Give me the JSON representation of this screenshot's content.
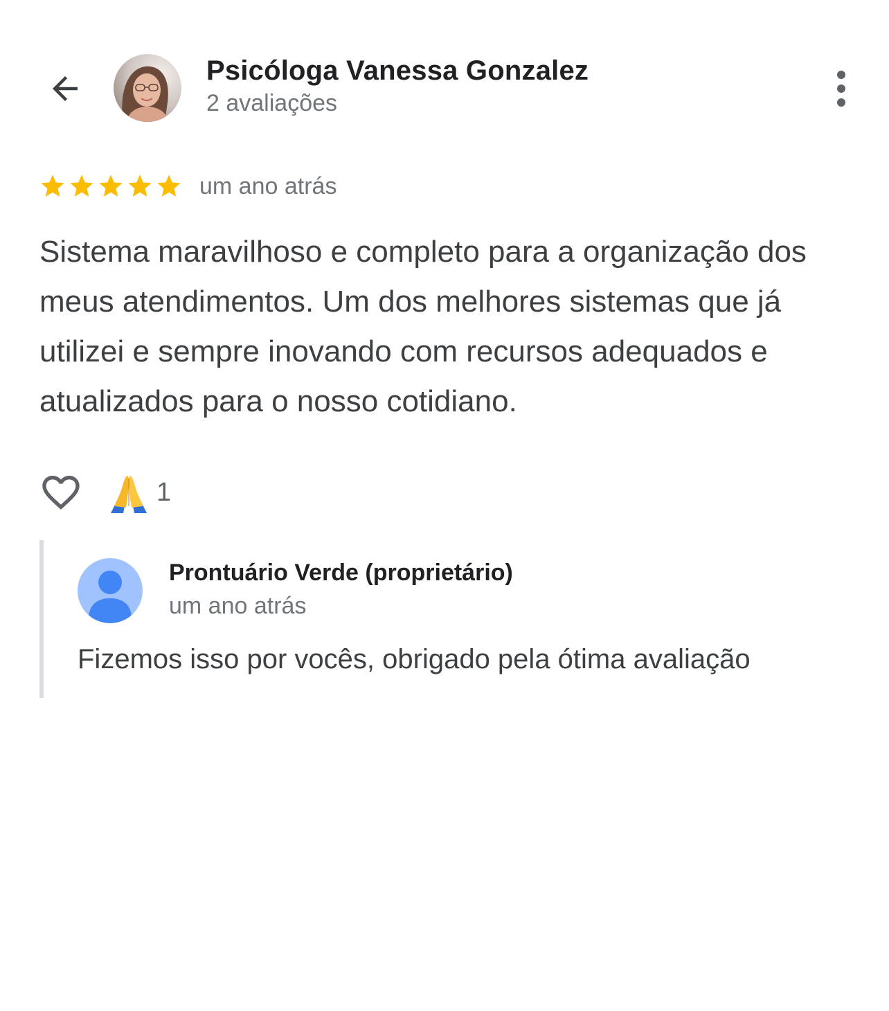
{
  "header": {
    "author_name": "Psicóloga Vanessa Gonzalez",
    "author_meta": "2 avaliações",
    "back_icon": "arrow-back-icon",
    "more_icon": "more-vert-icon"
  },
  "review": {
    "rating": 5,
    "rating_max": 5,
    "date": "um ano atrás",
    "star_color": "#fbbc04",
    "text": "Sistema maravilhoso e completo para a organização dos meus atendimentos. Um dos melhores sistemas que já utilizei e sempre inovando com recursos adequados e atualizados para o nosso cotidiano."
  },
  "reactions": {
    "like_icon": "heart-outline-icon",
    "emoji_icon": "folded-hands-emoji",
    "count": "1"
  },
  "owner_reply": {
    "name": "Prontuário Verde (proprietário)",
    "date": "um ano atrás",
    "text": "Fizemos isso por vocês, obrigado pela ótima avaliação",
    "avatar_icon": "default-profile-icon",
    "avatar_color": "#a0c3ff"
  }
}
